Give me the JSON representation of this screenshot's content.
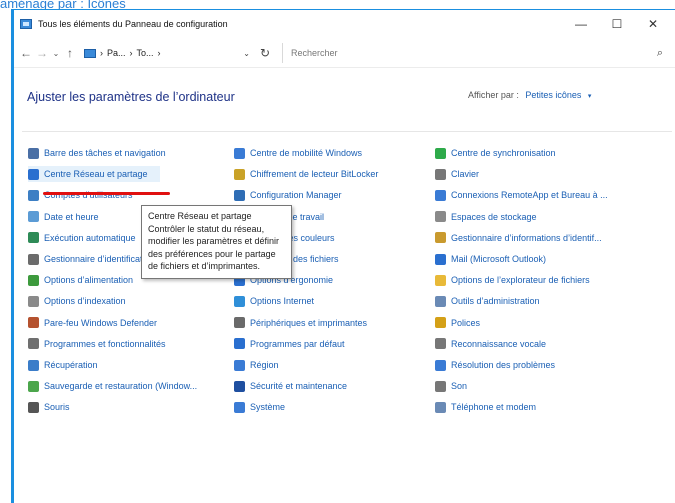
{
  "caption": "aménage par : Icônes",
  "window": {
    "title": "Tous les éléments du Panneau de configuration",
    "controls": {
      "minimize": "—",
      "maximize": "☐",
      "close": "✕"
    }
  },
  "address": {
    "back": "←",
    "forward": "→",
    "recent": "⌄",
    "up": "↑",
    "path": [
      "Pa...",
      "To..."
    ],
    "separator": "›",
    "dropdown": "⌄",
    "refresh": "↻",
    "search_placeholder": "Rechercher",
    "search_icon": "⌕"
  },
  "header": {
    "title": "Ajuster les paramètres de l’ordinateur",
    "view_by_label": "Afficher par :",
    "view_by_value": "Petites icônes",
    "view_by_arrow": "▾"
  },
  "items": [
    {
      "label": "Barre des tâches et navigation",
      "icon": "taskbar-icon",
      "color": "#4a6fa5"
    },
    {
      "label": "Centre Réseau et partage",
      "icon": "network-icon",
      "color": "#2a6fcf"
    },
    {
      "label": "Comptes d’utilisateurs",
      "icon": "users-icon",
      "color": "#3d7fc4"
    },
    {
      "label": "Date et heure",
      "icon": "clock-icon",
      "color": "#5b9bd5"
    },
    {
      "label": "Exécution automatique",
      "icon": "autoplay-icon",
      "color": "#2e8b57"
    },
    {
      "label": "Gestionnaire d’identification",
      "icon": "vault-icon",
      "color": "#6b6b6b"
    },
    {
      "label": "Options d’alimentation",
      "icon": "power-icon",
      "color": "#3d9a3d"
    },
    {
      "label": "Options d’indexation",
      "icon": "indexing-icon",
      "color": "#8a8a8a"
    },
    {
      "label": "Pare-feu Windows Defender",
      "icon": "firewall-icon",
      "color": "#b5522f"
    },
    {
      "label": "Programmes et fonctionnalités",
      "icon": "programs-icon",
      "color": "#6f6f6f"
    },
    {
      "label": "Récupération",
      "icon": "recovery-icon",
      "color": "#3b7dc9"
    },
    {
      "label": "Sauvegarde et restauration (Window...",
      "icon": "backup-icon",
      "color": "#4ca64c"
    },
    {
      "label": "Souris",
      "icon": "mouse-icon",
      "color": "#555555"
    },
    {
      "label": "Centre de mobilité Windows",
      "icon": "mobility-icon",
      "color": "#3a7bd5"
    },
    {
      "label": "Chiffrement de lecteur BitLocker",
      "icon": "bitlocker-icon",
      "color": "#c9a227"
    },
    {
      "label": "Configuration Manager",
      "icon": "config-manager-icon",
      "color": "#2f6db5"
    },
    {
      "label": "Dossiers de travail",
      "icon": "work-folders-icon",
      "color": "#3a7bd5"
    },
    {
      "label": "Gestion des couleurs",
      "icon": "color-icon",
      "color": "#3c8dde"
    },
    {
      "label": "Historique des fichiers",
      "icon": "history-icon",
      "color": "#3f9f3f"
    },
    {
      "label": "Options d’ergonomie",
      "icon": "ease-of-access-icon",
      "color": "#2a6fcf"
    },
    {
      "label": "Options Internet",
      "icon": "internet-icon",
      "color": "#2f8fd8"
    },
    {
      "label": "Périphériques et imprimantes",
      "icon": "printer-icon",
      "color": "#6a6a6a"
    },
    {
      "label": "Programmes par défaut",
      "icon": "default-programs-icon",
      "color": "#2a6fcf"
    },
    {
      "label": "Région",
      "icon": "region-icon",
      "color": "#3a7bd5"
    },
    {
      "label": "Sécurité et maintenance",
      "icon": "flag-icon",
      "color": "#1f4fa0"
    },
    {
      "label": "Système",
      "icon": "system-icon",
      "color": "#3a7bd5"
    },
    {
      "label": "Centre de synchronisation",
      "icon": "sync-icon",
      "color": "#2eaa4a"
    },
    {
      "label": "Clavier",
      "icon": "keyboard-icon",
      "color": "#777777"
    },
    {
      "label": "Connexions RemoteApp et Bureau à ...",
      "icon": "remoteapp-icon",
      "color": "#3a7bd5"
    },
    {
      "label": "Espaces de stockage",
      "icon": "storage-icon",
      "color": "#8a8a8a"
    },
    {
      "label": "Gestionnaire d’informations d’identif...",
      "icon": "credential-icon",
      "color": "#c99a2e"
    },
    {
      "label": "Mail (Microsoft Outlook)",
      "icon": "mail-icon",
      "color": "#2a6fcf"
    },
    {
      "label": "Options de l’explorateur de fichiers",
      "icon": "folder-options-icon",
      "color": "#e8b938"
    },
    {
      "label": "Outils d’administration",
      "icon": "admin-tools-icon",
      "color": "#6a8ab5"
    },
    {
      "label": "Polices",
      "icon": "fonts-icon",
      "color": "#d4a017"
    },
    {
      "label": "Reconnaissance vocale",
      "icon": "microphone-icon",
      "color": "#777777"
    },
    {
      "label": "Résolution des problèmes",
      "icon": "troubleshoot-icon",
      "color": "#3a7bd5"
    },
    {
      "label": "Son",
      "icon": "speaker-icon",
      "color": "#777777"
    },
    {
      "label": "Téléphone et modem",
      "icon": "phone-icon",
      "color": "#6a8ab5"
    }
  ],
  "tooltip": {
    "title": "Centre Réseau et partage",
    "body": "Contrôler le statut du réseau, modifier les paramètres et définir des préférences pour le partage de fichiers et d’imprimantes."
  }
}
